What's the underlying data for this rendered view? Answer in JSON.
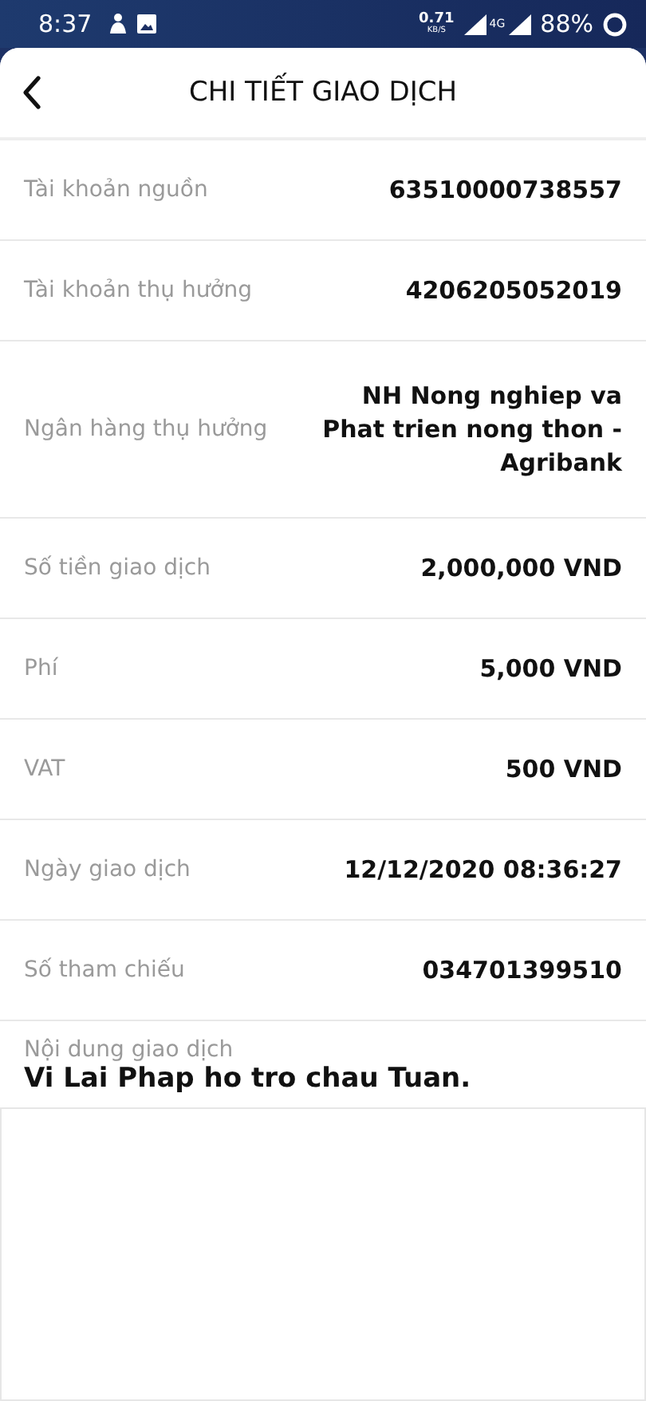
{
  "status_bar": {
    "time": "8:37",
    "speed": "0.71",
    "speed_unit": "KB/S",
    "network": "4G",
    "battery": "88%"
  },
  "header": {
    "title": "CHI TIẾT GIAO DỊCH"
  },
  "details": [
    {
      "label": "Tài khoản nguồn",
      "value": "63510000738557"
    },
    {
      "label": "Tài khoản thụ hưởng",
      "value": "4206205052019"
    },
    {
      "label": "Ngân hàng thụ hưởng",
      "value": "NH Nong nghiep va Phat trien nong thon - Agribank"
    },
    {
      "label": "Số tiền giao dịch",
      "value": "2,000,000 VND"
    },
    {
      "label": "Phí",
      "value": "5,000 VND"
    },
    {
      "label": "VAT",
      "value": "500 VND"
    },
    {
      "label": "Ngày giao dịch",
      "value": "12/12/2020 08:36:27"
    },
    {
      "label": "Số tham chiếu",
      "value": "034701399510"
    }
  ],
  "note": {
    "label": "Nội dung giao dịch",
    "value": "Vi Lai Phap ho tro chau Tuan."
  }
}
